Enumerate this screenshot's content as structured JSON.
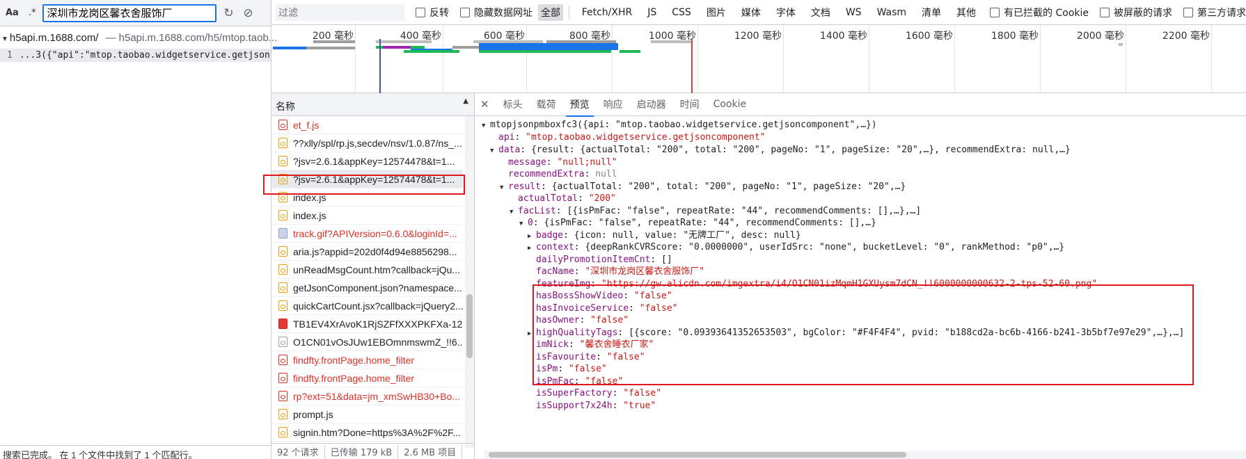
{
  "search": {
    "case_label": "Aa",
    "regex_label": ".*",
    "query": "深圳市龙岗区馨衣舍服饰厂",
    "refresh_icon": "refresh-icon",
    "clear_icon": "clear-icon",
    "result_file": "h5api.m.1688.com/",
    "result_path": "— h5api.m.1688.com/h5/mtop.taob...",
    "result_line_no": "1",
    "result_line_text": "...3({\"api\":\"mtop.taobao.widgetservice.getjsoncompo...",
    "status": "搜索已完成。 在 1 个文件中找到了 1 个匹配行。"
  },
  "filterbar": {
    "placeholder": "过滤",
    "invert": "反转",
    "hide_data_urls": "隐藏数据网址",
    "types": [
      "全部",
      "Fetch/XHR",
      "JS",
      "CSS",
      "图片",
      "媒体",
      "字体",
      "文档",
      "WS",
      "Wasm",
      "清单",
      "其他"
    ],
    "blocked_cookies": "有已拦截的 Cookie",
    "blocked_requests": "被屏蔽的请求",
    "third_party": "第三方请求"
  },
  "overview": {
    "ticks": [
      "200 毫秒",
      "400 毫秒",
      "600 毫秒",
      "800 毫秒",
      "1000 毫秒",
      "1200 毫秒",
      "1400 毫秒",
      "1600 毫秒",
      "1800 毫秒",
      "2000 毫秒",
      "2200 毫秒"
    ]
  },
  "requests": {
    "header": "名称",
    "rows": [
      {
        "name": "et_f.js",
        "kind": "err"
      },
      {
        "name": "??xlly/spl/rp.js,secdev/nsv/1.0.87/ns_...",
        "kind": "js"
      },
      {
        "name": "?jsv=2.6.1&appKey=12574478&t=1...",
        "kind": "js"
      },
      {
        "name": "?jsv=2.6.1&appKey=12574478&t=1...",
        "kind": "selected"
      },
      {
        "name": "index.js",
        "kind": "js"
      },
      {
        "name": "index.js",
        "kind": "js"
      },
      {
        "name": "track.gif?APIVersion=0.6.0&loginId=...",
        "kind": "errimg"
      },
      {
        "name": "aria.js?appid=202d0f4d94e8856298...",
        "kind": "js"
      },
      {
        "name": "unReadMsgCount.htm?callback=jQu...",
        "kind": "js"
      },
      {
        "name": "getJsonComponent.json?namespace...",
        "kind": "js"
      },
      {
        "name": "quickCartCount.jsx?callback=jQuery2...",
        "kind": "js"
      },
      {
        "name": "TB1EV4XrAvoK1RjSZFfXXXPKFXa-12...",
        "kind": "red"
      },
      {
        "name": "O1CN01vOsJUw1EBOmnmswmZ_!!6...",
        "kind": "plain"
      },
      {
        "name": "findfty.frontPage.home_filter",
        "kind": "err"
      },
      {
        "name": "findfty.frontPage.home_filter",
        "kind": "err"
      },
      {
        "name": "rp?ext=51&data=jm_xmSwHB30+Bo...",
        "kind": "err"
      },
      {
        "name": "prompt.js",
        "kind": "js"
      },
      {
        "name": "signin.htm?Done=https%3A%2F%2F...",
        "kind": "js"
      }
    ],
    "summary": [
      "92 个请求",
      "已传输 179 kB",
      "2.6 MB 项目"
    ]
  },
  "details": {
    "tabs": [
      "标头",
      "载荷",
      "预览",
      "响应",
      "启动器",
      "时间",
      "Cookie"
    ],
    "active_tab": "预览",
    "json": {
      "root": "mtopjsonpmboxfc3({api: \"mtop.taobao.widgetservice.getjsoncomponent\",…})",
      "api_key": "api",
      "api_val": "\"mtop.taobao.widgetservice.getjsoncomponent\"",
      "data_key": "data",
      "data_summary": "{result: {actualTotal: \"200\", total: \"200\", pageNo: \"1\", pageSize: \"20\",…}, recommendExtra: null,…}",
      "message_key": "message",
      "message_val": "\"null;null\"",
      "recommendExtra_key": "recommendExtra",
      "recommendExtra_val": "null",
      "result_key": "result",
      "result_summary": "{actualTotal: \"200\", total: \"200\", pageNo: \"1\", pageSize: \"20\",…}",
      "actualTotal_key": "actualTotal",
      "actualTotal_val": "\"200\"",
      "facList_key": "facList",
      "facList_summary": "[{isPmFac: \"false\", repeatRate: \"44\", recommendComments: [],…},…]",
      "item0_key": "0",
      "item0_summary": "{isPmFac: \"false\", repeatRate: \"44\", recommendComments: [],…}",
      "badge_key": "badge",
      "badge_summary": "{icon: null, value: \"无牌工厂\", desc: null}",
      "context_key": "context",
      "context_summary": "{deepRankCVRScore: \"0.0000000\", userIdSrc: \"none\", bucketLevel: \"0\", rankMethod: \"p0\",…}",
      "dailyPromotion_key": "dailyPromotionItemCnt",
      "dailyPromotion_val": "[]",
      "facName_key": "facName",
      "facName_val": "\"深圳市龙岗区馨衣舍服饰厂\"",
      "featureImg_key": "featureImg",
      "featureImg_val": "\"https://gw.alicdn.com/imgextra/i4/O1CN01izMqmH1GXUysm7dCN_!!6000000000632-2-tps-52-60.png\"",
      "hasBossShowVideo_key": "hasBossShowVideo",
      "hasBossShowVideo_val": "\"false\"",
      "hasInvoiceService_key": "hasInvoiceService",
      "hasInvoiceService_val": "\"false\"",
      "hasOwner_key": "hasOwner",
      "hasOwner_val": "\"false\"",
      "highQualityTags_key": "highQualityTags",
      "highQualityTags_summary": "[{score: \"0.09393641352653503\", bgColor: \"#F4F4F4\", pvid: \"b188cd2a-bc6b-4166-b241-3b5bf7e97e29\",…},…]",
      "imNick_key": "imNick",
      "imNick_val": "\"馨衣舍睡衣厂家\"",
      "isFavourite_key": "isFavourite",
      "isFavourite_val": "\"false\"",
      "isPm_key": "isPm",
      "isPm_val": "\"false\"",
      "isPmFac_key": "isPmFac",
      "isPmFac_val": "\"false\"",
      "isSuperFactory_key": "isSuperFactory",
      "isSuperFactory_val": "\"false\"",
      "isSupport7x24h_key": "isSupport7x24h",
      "isSupport7x24h_val": "\"true\""
    }
  },
  "colors": {
    "highlight_box": "#e0181c",
    "json_key": "#881280",
    "json_string": "#c41a16",
    "accent": "#1a73e8"
  }
}
